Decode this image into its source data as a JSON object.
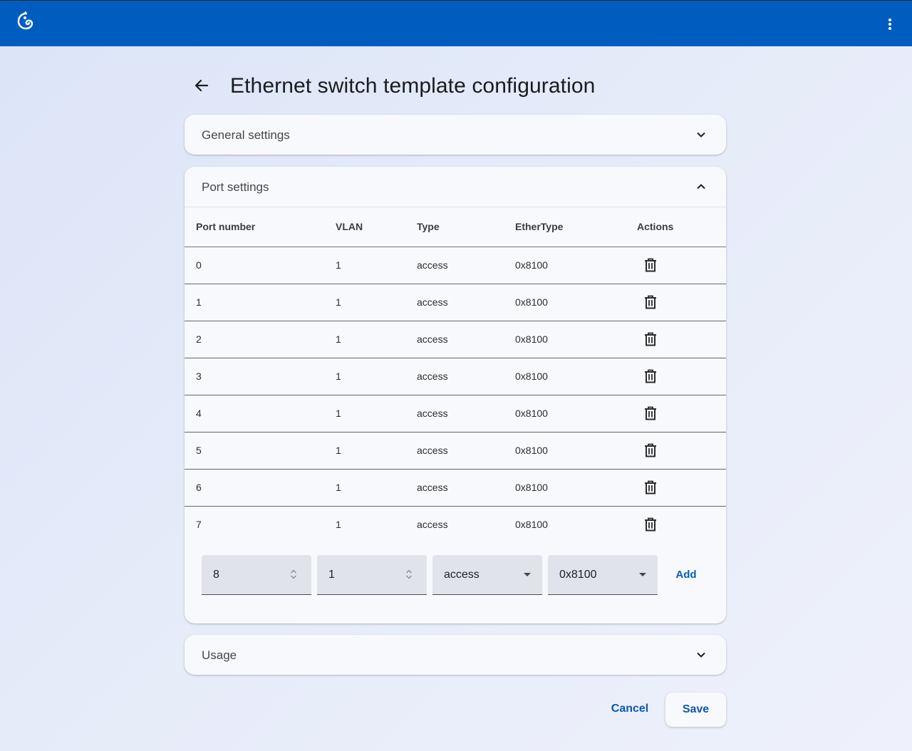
{
  "app": {
    "logo_icon": "chameleon-logo-icon",
    "menu_icon": "more-vert-icon"
  },
  "page": {
    "title": "Ethernet switch template configuration",
    "back_icon": "arrow-back-icon"
  },
  "sections": {
    "general": {
      "title": "General settings",
      "expanded": false
    },
    "ports": {
      "title": "Port settings",
      "expanded": true
    },
    "usage": {
      "title": "Usage",
      "expanded": false
    }
  },
  "table": {
    "headers": {
      "port": "Port number",
      "vlan": "VLAN",
      "type": "Type",
      "ethertype": "EtherType",
      "actions": "Actions"
    },
    "rows": [
      {
        "port": "0",
        "vlan": "1",
        "type": "access",
        "ethertype": "0x8100"
      },
      {
        "port": "1",
        "vlan": "1",
        "type": "access",
        "ethertype": "0x8100"
      },
      {
        "port": "2",
        "vlan": "1",
        "type": "access",
        "ethertype": "0x8100"
      },
      {
        "port": "3",
        "vlan": "1",
        "type": "access",
        "ethertype": "0x8100"
      },
      {
        "port": "4",
        "vlan": "1",
        "type": "access",
        "ethertype": "0x8100"
      },
      {
        "port": "5",
        "vlan": "1",
        "type": "access",
        "ethertype": "0x8100"
      },
      {
        "port": "6",
        "vlan": "1",
        "type": "access",
        "ethertype": "0x8100"
      },
      {
        "port": "7",
        "vlan": "1",
        "type": "access",
        "ethertype": "0x8100"
      }
    ],
    "delete_icon": "trash-icon"
  },
  "new_row": {
    "port": "8",
    "vlan": "1",
    "type": "access",
    "ethertype": "0x8100",
    "add_label": "Add"
  },
  "footer": {
    "cancel_label": "Cancel",
    "save_label": "Save"
  },
  "colors": {
    "topbar": "#005dc0",
    "accent": "#0b58b0"
  }
}
